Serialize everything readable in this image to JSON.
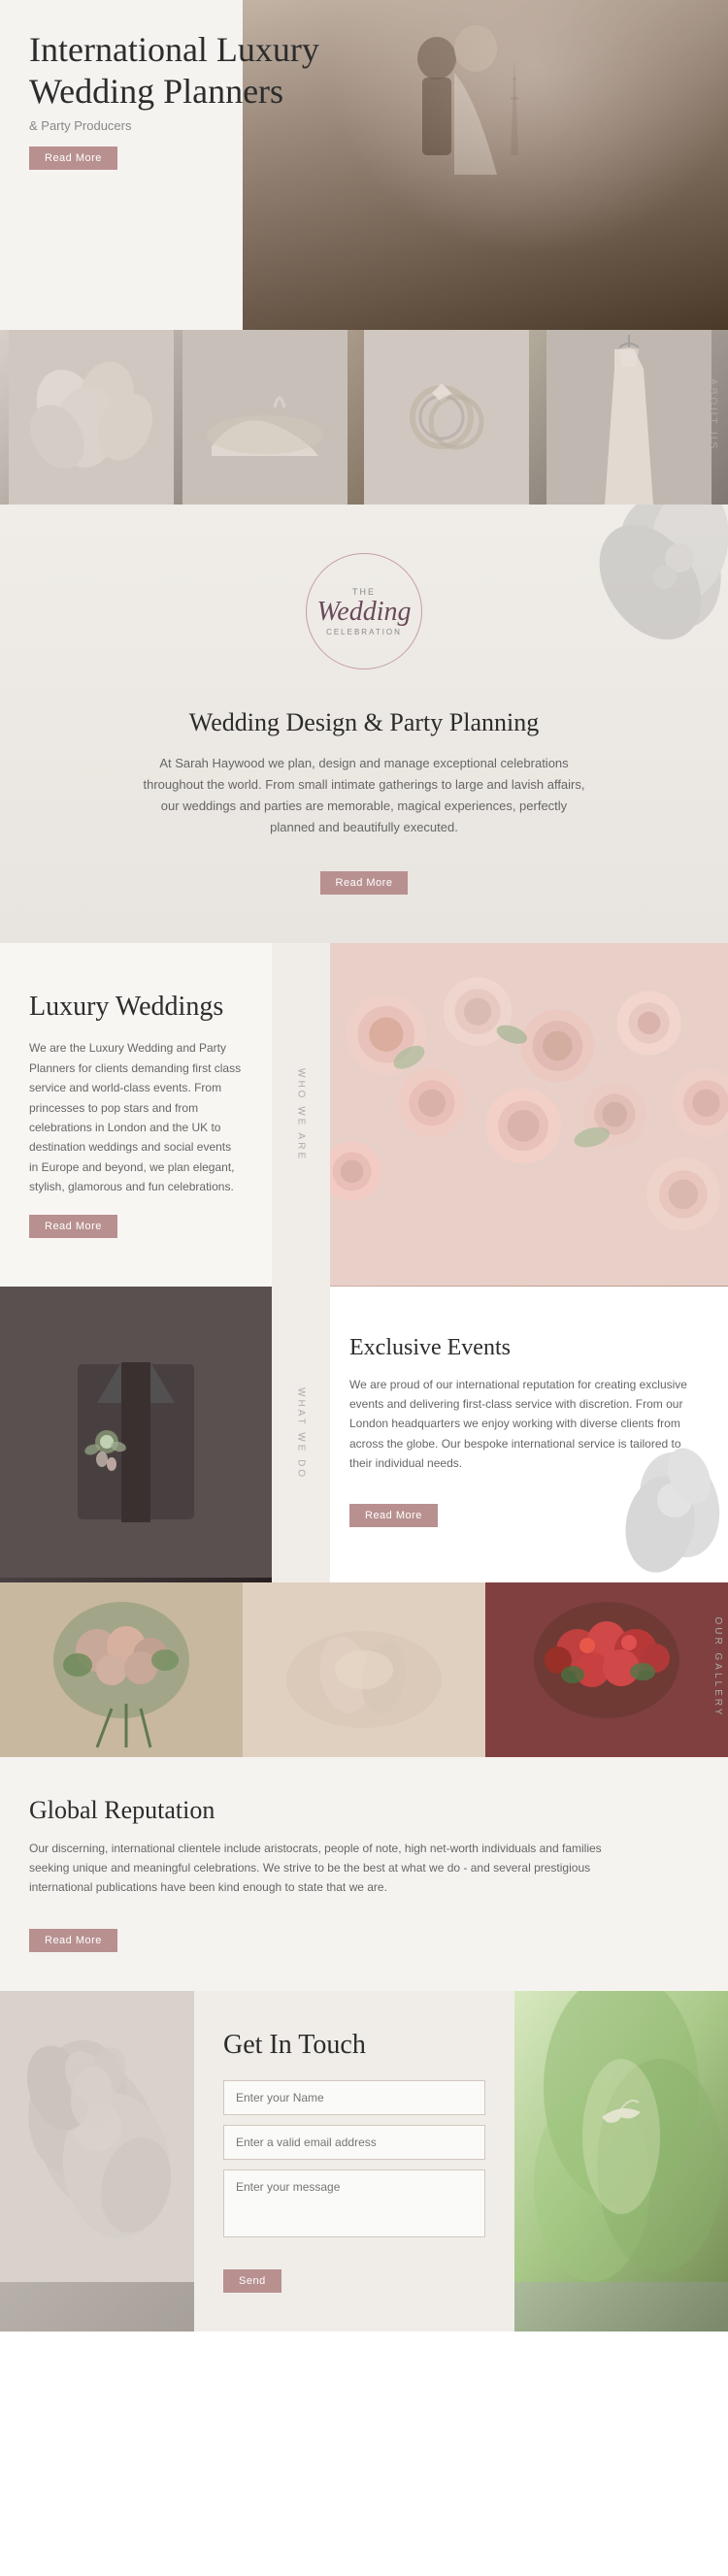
{
  "hero": {
    "title_line1": "International Luxury",
    "title_line2": "Wedding Planners",
    "subtitle": "& Party Producers",
    "cta_label": "Read More"
  },
  "about_us": {
    "label": "ABOUT US"
  },
  "wedding_design": {
    "logo_the": "THE",
    "logo_main": "Wedding",
    "logo_sub": "CELEBRATION",
    "heading": "Wedding Design & Party Planning",
    "body": "At Sarah Haywood we plan, design and manage exceptional celebrations throughout the world. From small intimate gatherings to large and lavish affairs, our weddings and parties are memorable, magical experiences, perfectly planned and beautifully executed.",
    "cta_label": "Read More"
  },
  "who_we_are": {
    "label": "WHO WE ARE",
    "heading": "Luxury Weddings",
    "body": "We are the Luxury Wedding and Party Planners for clients demanding first class service and world-class events. From princesses to pop stars and from celebrations in London and the UK to destination weddings and social events in Europe and beyond, we plan elegant, stylish, glamorous and fun celebrations.",
    "cta_label": "Read More"
  },
  "what_we_do": {
    "label": "WHAT WE DO",
    "heading": "Exclusive Events",
    "body": "We are proud of our international reputation for creating exclusive events and delivering first-class service with discretion. From our London headquarters we enjoy working with diverse clients from across the globe. Our bespoke international service is tailored to their individual needs.",
    "cta_label": "Read More"
  },
  "gallery": {
    "label": "OUR GALLERY"
  },
  "global_rep": {
    "heading": "Global Reputation",
    "body": "Our discerning, international clientele include aristocrats, people of note, high net-worth individuals and families seeking unique and meaningful celebrations. We strive to be the best at what we do - and several prestigious international publications have been kind enough to state that we are.",
    "cta_label": "Read More"
  },
  "contact": {
    "heading": "Get In Touch",
    "name_placeholder": "Enter your Name",
    "email_placeholder": "Enter a valid email address",
    "message_placeholder": "Enter your message",
    "submit_label": "Send"
  }
}
